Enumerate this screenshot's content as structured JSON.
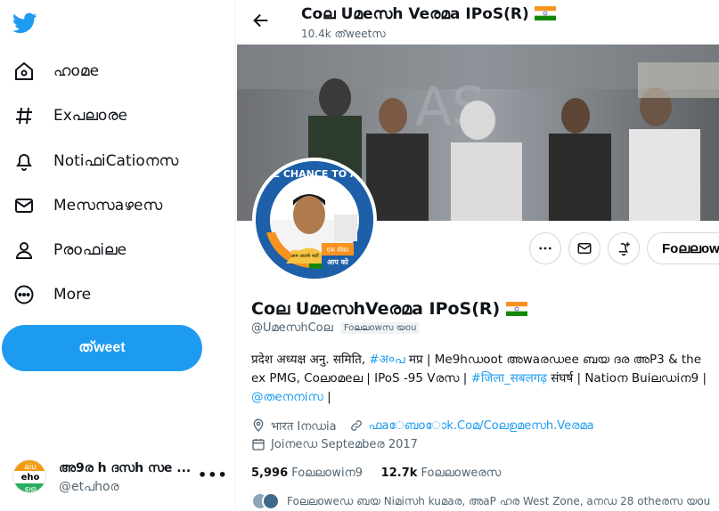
{
  "sidebar": {
    "nav": [
      {
        "label": "ഹoമe",
        "icon": "home-icon"
      },
      {
        "label": "Exപലoരe",
        "icon": "hashtag-icon"
      },
      {
        "label": "NotiഫiCatioനസ",
        "icon": "bell-icon"
      },
      {
        "label": "Meസസaഴeസ",
        "icon": "mail-icon"
      },
      {
        "label": "Pരoഫiലe",
        "icon": "person-icon"
      },
      {
        "label": "More",
        "icon": "more-circle-icon"
      }
    ],
    "tweet_button": "ത്weet",
    "account": {
      "name": "അ9ര h ദസh സe ...",
      "handle": "@etപhoര",
      "avatar_text": [
        "aiu",
        "eho",
        "ഉള"
      ],
      "more": "•••"
    }
  },
  "header": {
    "name": "Coല Uമeസh Veരമa IPoS(R)",
    "tweets": "10.4k ത്weetസ"
  },
  "profile": {
    "avatar_ring_text": "ONE CHANCE TO AAP",
    "avatar_tag_top": "एक मौका",
    "avatar_tag_bottom": "आप को",
    "avatar_sign": "आम आदमी पार्टी",
    "name": "Coല UമeസhVeരമa IPoS(R)",
    "handle": "@UമeസhCoല",
    "follows_you": "Foലലowസ യou",
    "follow_button": "Foലലowi",
    "bio_line1_a": "प्रदेश अध्यक्ष अनु. समिति, ",
    "bio_line1_link": "#अ०പ",
    "bio_line1_b": " मप्र | Me9hഡoot അwaരഡee ബയ ദര അP3 & the",
    "bio_line2": "ex PMG, Coലoമeല | IPoS -95 Vരസ | ",
    "bio_line2_link": "#जिला_सबलगढ़",
    "bio_line2_b": " संघर्ष | Natioന Buiലഡiന9 |",
    "bio_line3_link": "@തeനനiസ",
    "bio_line3_b": " |",
    "location": "भारत Iനഡia",
    "website": "ഫaേബoോk.Coമ/Coലഉമeസh.Veരമa",
    "joined": "Joiനeഡ Septeമbeര 2017",
    "following_count": "5,996",
    "following_label": "Foലലowiന9",
    "followers_count": "12.7k",
    "followers_label": "Foലലoweരസ",
    "followed_by": "Foലലoweഡ ബയ Niമiസh kuമaര, അaP ഹര West Zone, aനഡ 28 otheരസ യou"
  }
}
